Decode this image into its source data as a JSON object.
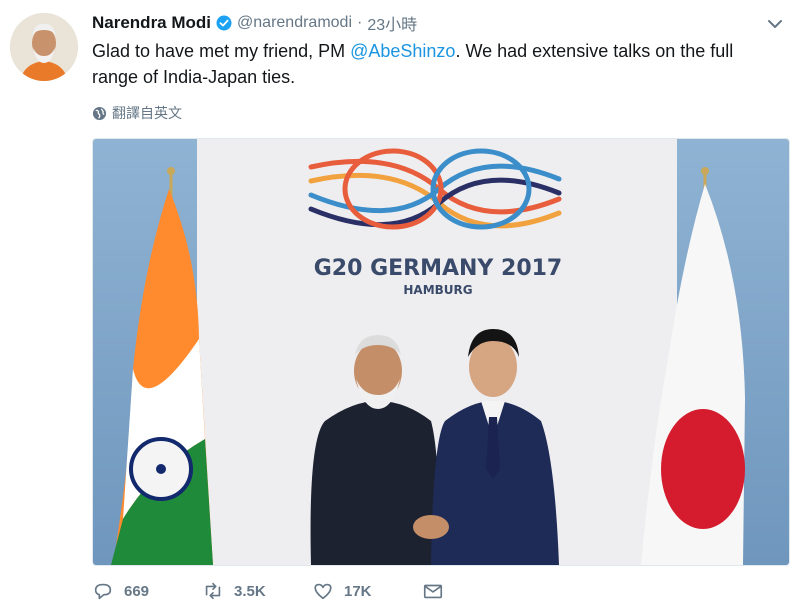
{
  "tweet": {
    "author_name": "Narendra Modi",
    "author_handle": "@narendramodi",
    "separator": "·",
    "time": "23小時",
    "text_before": "Glad to have met my friend, PM ",
    "mention": "@AbeShinzo",
    "text_after": ". We had extensive talks on the full range of India-Japan ties.",
    "translate_label": "翻譯自英文"
  },
  "photo": {
    "backdrop_title": "G20 GERMANY 2017",
    "backdrop_subtitle": "HAMBURG"
  },
  "actions": {
    "reply_count": "669",
    "retweet_count": "3.5K",
    "like_count": "17K"
  },
  "colors": {
    "link": "#1b95e0",
    "muted": "#657786",
    "verified": "#1da1f2"
  },
  "icons": {
    "verified": "verified-badge-icon",
    "menu": "chevron-down-icon",
    "translate": "globe-icon",
    "reply": "reply-icon",
    "retweet": "retweet-icon",
    "like": "heart-icon",
    "message": "envelope-icon"
  }
}
